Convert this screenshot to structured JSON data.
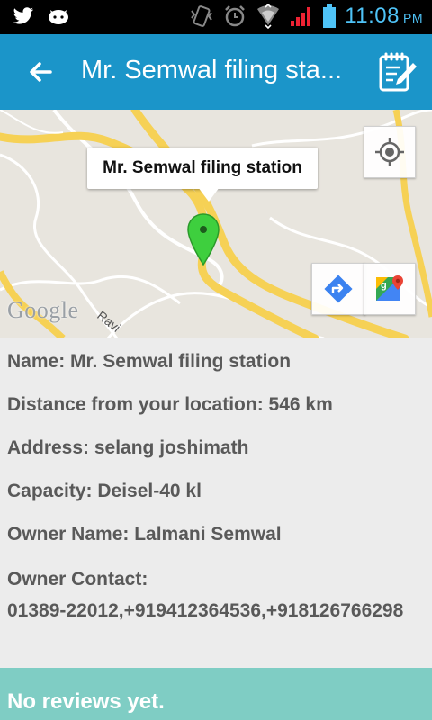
{
  "status_bar": {
    "time": "11:08",
    "ampm": "PM",
    "icons": [
      "twitter-icon",
      "messenger-icon",
      "vibrate-icon",
      "alarm-icon",
      "wifi-icon",
      "signal-icon",
      "battery-icon"
    ]
  },
  "app_bar": {
    "title": "Mr. Semwal filing sta...",
    "back_icon": "arrow-back-icon",
    "action_icon": "edit-note-icon"
  },
  "map": {
    "marker_title": "Mr. Semwal filing station",
    "attribution": "Google",
    "road_label": "Ravi",
    "controls": [
      "my-location-icon",
      "directions-icon",
      "google-maps-icon"
    ]
  },
  "details": {
    "name": "Name: Mr. Semwal filing station",
    "distance": "Distance from your location: 546 km",
    "address": "Address: selang joshimath",
    "capacity": "Capacity: Deisel-40 kl",
    "owner_name": "Owner Name: Lalmani Semwal",
    "owner_contact_label": "Owner Contact:",
    "owner_contact_value": "01389-22012,+919412364536,+918126766298"
  },
  "reviews": {
    "text": "No reviews yet."
  },
  "colors": {
    "app_bar": "#1b95c9",
    "status_bar": "#000000",
    "time_text": "#4fc3f7",
    "reviews_bar": "#7fcdc4",
    "marker": "#3ecf3e",
    "road": "#f6d155"
  }
}
